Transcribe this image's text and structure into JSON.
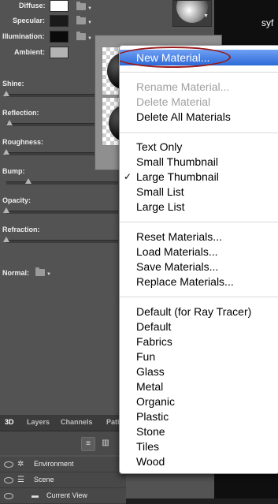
{
  "properties": {
    "diffuse": {
      "label": "Diffuse:",
      "color": "#ffffff"
    },
    "specular": {
      "label": "Specular:",
      "color": "#1a1a1a"
    },
    "illumination": {
      "label": "Illumination:",
      "color": "#0a0a0a"
    },
    "ambient": {
      "label": "Ambient:",
      "color": "#b3b3b3"
    }
  },
  "sliders": [
    {
      "label": "Shine:",
      "level": 0.0
    },
    {
      "label": "Reflection:",
      "level": 0.03
    },
    {
      "label": "Roughness:",
      "level": 0.0
    },
    {
      "label": "Bump:",
      "level": 0.2
    },
    {
      "label": "Opacity:",
      "level": 0.0
    },
    {
      "label": "Refraction:",
      "level": 0.0
    }
  ],
  "normal": {
    "label": "Normal:"
  },
  "canvas_label": "syf",
  "tabs": [
    "3D",
    "Layers",
    "Channels",
    "Pati"
  ],
  "scene_rows": [
    {
      "label": "Environment"
    },
    {
      "label": "Scene"
    },
    {
      "label": "Current View"
    }
  ],
  "menu": {
    "new_material": "New Material...",
    "rename_material": "Rename Material...",
    "delete_material": "Delete Material",
    "delete_all": "Delete All Materials",
    "view_options": [
      "Text Only",
      "Small Thumbnail",
      "Large Thumbnail",
      "Small List",
      "Large List"
    ],
    "checked_view": "Large Thumbnail",
    "check_mark": "✓",
    "library_actions": [
      "Reset Materials...",
      "Load Materials...",
      "Save Materials...",
      "Replace Materials..."
    ],
    "presets": [
      "Default (for Ray Tracer)",
      "Default",
      "Fabrics",
      "Fun",
      "Glass",
      "Metal",
      "Organic",
      "Plastic",
      "Stone",
      "Tiles",
      "Wood"
    ]
  }
}
